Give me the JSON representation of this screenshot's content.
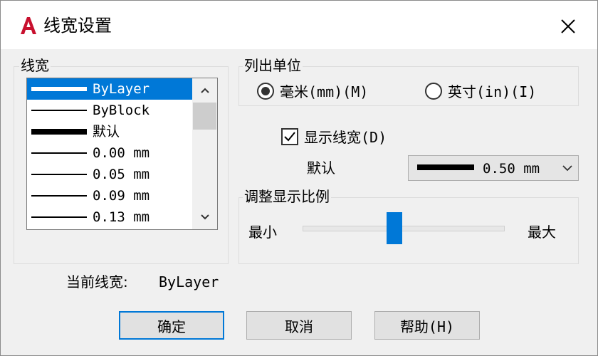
{
  "window": {
    "title": "线宽设置"
  },
  "lineweights": {
    "label": "线宽",
    "items": [
      {
        "label": "ByLayer",
        "weight": 6,
        "selected": true
      },
      {
        "label": "ByBlock",
        "weight": 2,
        "selected": false
      },
      {
        "label": "默认",
        "weight": 8,
        "selected": false
      },
      {
        "label": "0.00 mm",
        "weight": 2,
        "selected": false
      },
      {
        "label": "0.05 mm",
        "weight": 2,
        "selected": false
      },
      {
        "label": "0.09 mm",
        "weight": 2,
        "selected": false
      },
      {
        "label": "0.13 mm",
        "weight": 2,
        "selected": false
      }
    ]
  },
  "units": {
    "label": "列出单位",
    "mm_label": "毫米(mm)(M)",
    "in_label": "英寸(in)(I)",
    "selected": "mm"
  },
  "display": {
    "checkbox_label": "显示线宽(D)",
    "checked": true
  },
  "default": {
    "label": "默认",
    "value": "0.50 mm"
  },
  "scale": {
    "label": "调整显示比例",
    "min_label": "最小",
    "max_label": "最大",
    "value_fraction": 0.45
  },
  "current": {
    "label": "当前线宽:",
    "value": "ByLayer"
  },
  "buttons": {
    "ok": "确定",
    "cancel": "取消",
    "help": "帮助(H)"
  },
  "colors": {
    "accent": "#0078d7",
    "app_icon": "#c8102e"
  }
}
